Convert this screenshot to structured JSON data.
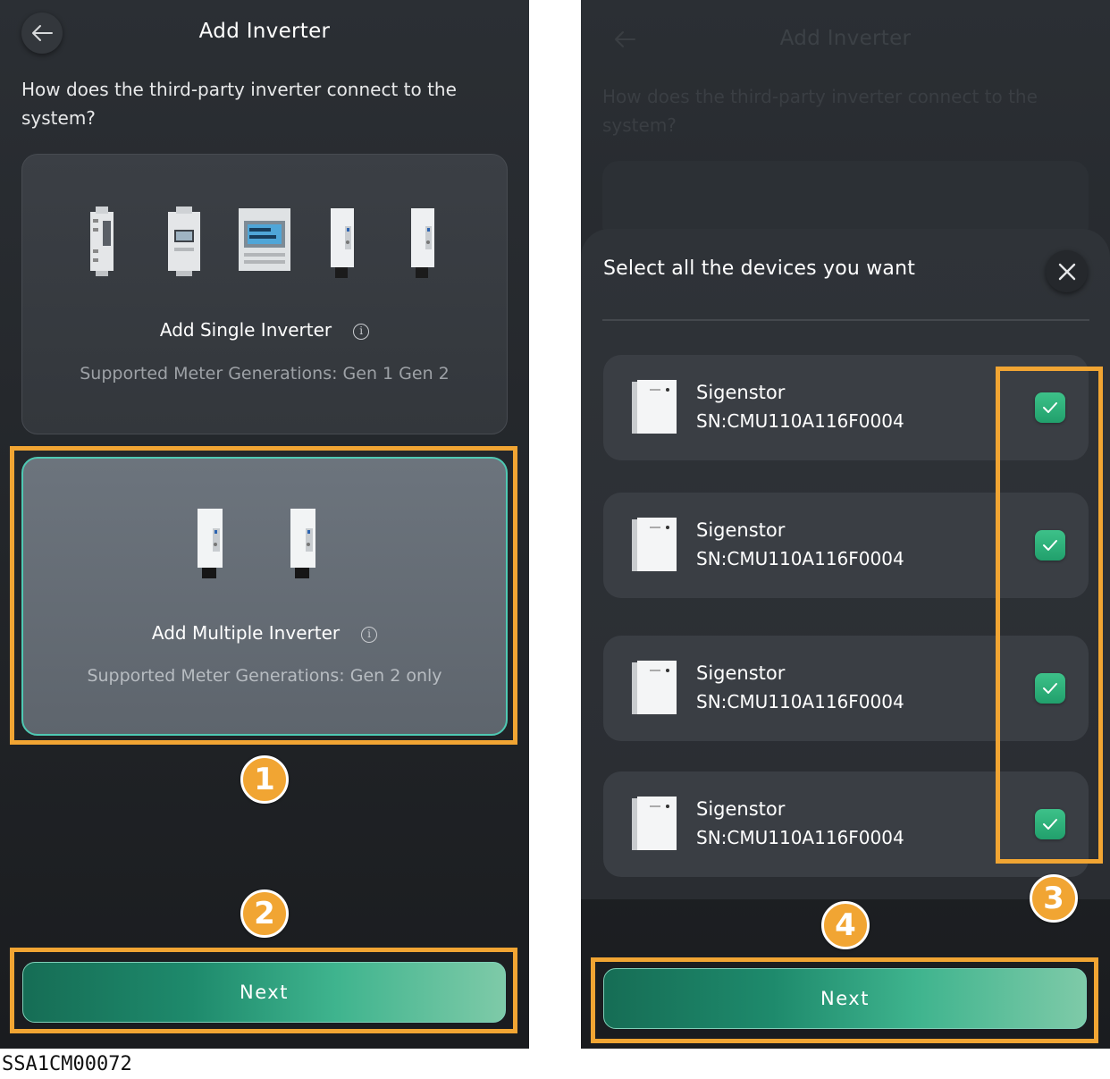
{
  "left_screen": {
    "header": {
      "title": "Add Inverter"
    },
    "question": "How does the third-party inverter connect to the system?",
    "options": [
      {
        "label": "Add Single Inverter",
        "info_icon": "info-icon",
        "subtitle": "Supported Meter Generations: Gen 1 Gen 2",
        "selected": false
      },
      {
        "label": "Add Multiple Inverter",
        "info_icon": "info-icon",
        "subtitle": "Supported Meter Generations: Gen 2 only",
        "selected": true
      }
    ],
    "next_label": "Next"
  },
  "right_screen": {
    "header": {
      "title": "Add Inverter"
    },
    "question": "How does the third-party inverter connect to the system?",
    "sheet": {
      "title": "Select all the devices you want",
      "devices": [
        {
          "name": "Sigenstor",
          "sn": "SN:CMU110A116F0004",
          "checked": true
        },
        {
          "name": "Sigenstor",
          "sn": "SN:CMU110A116F0004",
          "checked": true
        },
        {
          "name": "Sigenstor",
          "sn": "SN:CMU110A116F0004",
          "checked": true
        },
        {
          "name": "Sigenstor",
          "sn": "SN:CMU110A116F0004",
          "checked": true
        }
      ]
    },
    "next_label": "Next"
  },
  "annotations": {
    "step1": "1",
    "step2": "2",
    "step3": "3",
    "step4": "4"
  },
  "footer_code": "SSA1CM00072",
  "colors": {
    "highlight": "#f1a533",
    "selected_border": "#4fc9b3",
    "check": "#2aa874"
  }
}
